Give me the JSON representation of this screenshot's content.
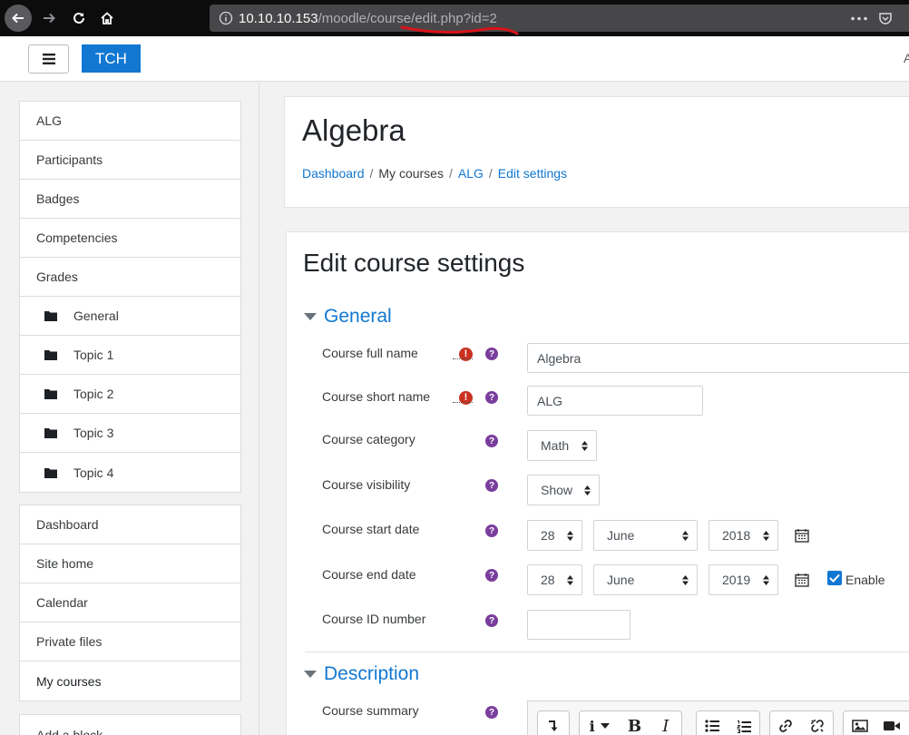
{
  "browser": {
    "url_host": "10.10.10.153",
    "url_path": "/moodle/course/edit.php?id=2",
    "menu_dots": "•••"
  },
  "navbar": {
    "brand": "TCH",
    "edge_glyph": "A"
  },
  "drawer": {
    "course_nav": [
      {
        "label": "ALG"
      },
      {
        "label": "Participants"
      },
      {
        "label": "Badges"
      },
      {
        "label": "Competencies"
      },
      {
        "label": "Grades"
      },
      {
        "label": "General"
      },
      {
        "label": "Topic 1"
      },
      {
        "label": "Topic 2"
      },
      {
        "label": "Topic 3"
      },
      {
        "label": "Topic 4"
      }
    ],
    "site_nav": [
      {
        "label": "Dashboard"
      },
      {
        "label": "Site home"
      },
      {
        "label": "Calendar"
      },
      {
        "label": "Private files"
      },
      {
        "label": "My courses"
      }
    ],
    "add_block": "Add a block"
  },
  "header": {
    "title": "Algebra",
    "breadcrumb": [
      "Dashboard",
      "My courses",
      "ALG",
      "Edit settings"
    ]
  },
  "form": {
    "heading": "Edit course settings",
    "section_general": "General",
    "section_description": "Description",
    "fields": {
      "fullname_label": "Course full name",
      "fullname_value": "Algebra",
      "shortname_label": "Course short name",
      "shortname_value": "ALG",
      "category_label": "Course category",
      "category_value": "Math",
      "visibility_label": "Course visibility",
      "visibility_value": "Show",
      "startdate_label": "Course start date",
      "start_day": "28",
      "start_month": "June",
      "start_year": "2018",
      "enddate_label": "Course end date",
      "end_day": "28",
      "end_month": "June",
      "end_year": "2019",
      "end_enable": "Enable",
      "idnumber_label": "Course ID number",
      "idnumber_value": "",
      "summary_label": "Course summary"
    },
    "required_glyph": "!",
    "help_glyph": "?"
  },
  "editor": {
    "bold": "B",
    "italic": "I",
    "info": "i"
  },
  "colors": {
    "accent": "#1177d1",
    "required": "#ca3120",
    "help": "#7a3e9d"
  }
}
